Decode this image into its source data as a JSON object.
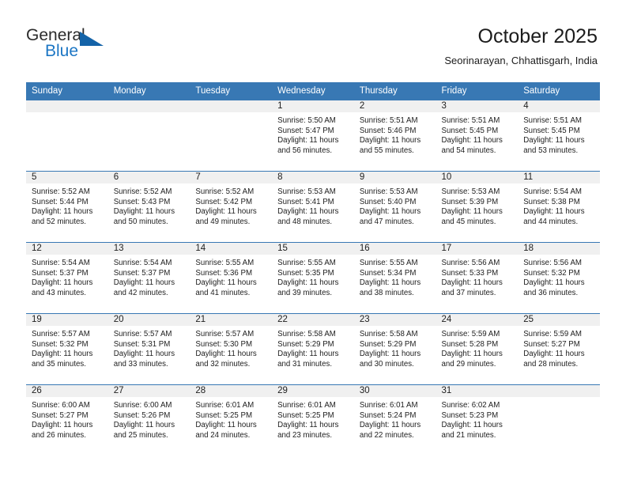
{
  "brand": {
    "name_part1": "General",
    "name_part2": "Blue",
    "triangle_icon": "triangle-icon",
    "accent_color": "#1463a8",
    "text_color": "#2b2b2b"
  },
  "header": {
    "title": "October 2025",
    "subtitle": "Seorinarayan, Chhattisgarh, India"
  },
  "theme": {
    "header_blue": "#3878b4",
    "daynum_band": "#f0f0f0",
    "text": "#1e1e1e"
  },
  "calendar": {
    "weekday_headers": [
      "Sunday",
      "Monday",
      "Tuesday",
      "Wednesday",
      "Thursday",
      "Friday",
      "Saturday"
    ],
    "weeks": [
      [
        {
          "day": "",
          "sunrise": "",
          "sunset": "",
          "daylight_line1": "",
          "daylight_line2": ""
        },
        {
          "day": "",
          "sunrise": "",
          "sunset": "",
          "daylight_line1": "",
          "daylight_line2": ""
        },
        {
          "day": "",
          "sunrise": "",
          "sunset": "",
          "daylight_line1": "",
          "daylight_line2": ""
        },
        {
          "day": "1",
          "sunrise": "Sunrise: 5:50 AM",
          "sunset": "Sunset: 5:47 PM",
          "daylight_line1": "Daylight: 11 hours",
          "daylight_line2": "and 56 minutes."
        },
        {
          "day": "2",
          "sunrise": "Sunrise: 5:51 AM",
          "sunset": "Sunset: 5:46 PM",
          "daylight_line1": "Daylight: 11 hours",
          "daylight_line2": "and 55 minutes."
        },
        {
          "day": "3",
          "sunrise": "Sunrise: 5:51 AM",
          "sunset": "Sunset: 5:45 PM",
          "daylight_line1": "Daylight: 11 hours",
          "daylight_line2": "and 54 minutes."
        },
        {
          "day": "4",
          "sunrise": "Sunrise: 5:51 AM",
          "sunset": "Sunset: 5:45 PM",
          "daylight_line1": "Daylight: 11 hours",
          "daylight_line2": "and 53 minutes."
        }
      ],
      [
        {
          "day": "5",
          "sunrise": "Sunrise: 5:52 AM",
          "sunset": "Sunset: 5:44 PM",
          "daylight_line1": "Daylight: 11 hours",
          "daylight_line2": "and 52 minutes."
        },
        {
          "day": "6",
          "sunrise": "Sunrise: 5:52 AM",
          "sunset": "Sunset: 5:43 PM",
          "daylight_line1": "Daylight: 11 hours",
          "daylight_line2": "and 50 minutes."
        },
        {
          "day": "7",
          "sunrise": "Sunrise: 5:52 AM",
          "sunset": "Sunset: 5:42 PM",
          "daylight_line1": "Daylight: 11 hours",
          "daylight_line2": "and 49 minutes."
        },
        {
          "day": "8",
          "sunrise": "Sunrise: 5:53 AM",
          "sunset": "Sunset: 5:41 PM",
          "daylight_line1": "Daylight: 11 hours",
          "daylight_line2": "and 48 minutes."
        },
        {
          "day": "9",
          "sunrise": "Sunrise: 5:53 AM",
          "sunset": "Sunset: 5:40 PM",
          "daylight_line1": "Daylight: 11 hours",
          "daylight_line2": "and 47 minutes."
        },
        {
          "day": "10",
          "sunrise": "Sunrise: 5:53 AM",
          "sunset": "Sunset: 5:39 PM",
          "daylight_line1": "Daylight: 11 hours",
          "daylight_line2": "and 45 minutes."
        },
        {
          "day": "11",
          "sunrise": "Sunrise: 5:54 AM",
          "sunset": "Sunset: 5:38 PM",
          "daylight_line1": "Daylight: 11 hours",
          "daylight_line2": "and 44 minutes."
        }
      ],
      [
        {
          "day": "12",
          "sunrise": "Sunrise: 5:54 AM",
          "sunset": "Sunset: 5:37 PM",
          "daylight_line1": "Daylight: 11 hours",
          "daylight_line2": "and 43 minutes."
        },
        {
          "day": "13",
          "sunrise": "Sunrise: 5:54 AM",
          "sunset": "Sunset: 5:37 PM",
          "daylight_line1": "Daylight: 11 hours",
          "daylight_line2": "and 42 minutes."
        },
        {
          "day": "14",
          "sunrise": "Sunrise: 5:55 AM",
          "sunset": "Sunset: 5:36 PM",
          "daylight_line1": "Daylight: 11 hours",
          "daylight_line2": "and 41 minutes."
        },
        {
          "day": "15",
          "sunrise": "Sunrise: 5:55 AM",
          "sunset": "Sunset: 5:35 PM",
          "daylight_line1": "Daylight: 11 hours",
          "daylight_line2": "and 39 minutes."
        },
        {
          "day": "16",
          "sunrise": "Sunrise: 5:55 AM",
          "sunset": "Sunset: 5:34 PM",
          "daylight_line1": "Daylight: 11 hours",
          "daylight_line2": "and 38 minutes."
        },
        {
          "day": "17",
          "sunrise": "Sunrise: 5:56 AM",
          "sunset": "Sunset: 5:33 PM",
          "daylight_line1": "Daylight: 11 hours",
          "daylight_line2": "and 37 minutes."
        },
        {
          "day": "18",
          "sunrise": "Sunrise: 5:56 AM",
          "sunset": "Sunset: 5:32 PM",
          "daylight_line1": "Daylight: 11 hours",
          "daylight_line2": "and 36 minutes."
        }
      ],
      [
        {
          "day": "19",
          "sunrise": "Sunrise: 5:57 AM",
          "sunset": "Sunset: 5:32 PM",
          "daylight_line1": "Daylight: 11 hours",
          "daylight_line2": "and 35 minutes."
        },
        {
          "day": "20",
          "sunrise": "Sunrise: 5:57 AM",
          "sunset": "Sunset: 5:31 PM",
          "daylight_line1": "Daylight: 11 hours",
          "daylight_line2": "and 33 minutes."
        },
        {
          "day": "21",
          "sunrise": "Sunrise: 5:57 AM",
          "sunset": "Sunset: 5:30 PM",
          "daylight_line1": "Daylight: 11 hours",
          "daylight_line2": "and 32 minutes."
        },
        {
          "day": "22",
          "sunrise": "Sunrise: 5:58 AM",
          "sunset": "Sunset: 5:29 PM",
          "daylight_line1": "Daylight: 11 hours",
          "daylight_line2": "and 31 minutes."
        },
        {
          "day": "23",
          "sunrise": "Sunrise: 5:58 AM",
          "sunset": "Sunset: 5:29 PM",
          "daylight_line1": "Daylight: 11 hours",
          "daylight_line2": "and 30 minutes."
        },
        {
          "day": "24",
          "sunrise": "Sunrise: 5:59 AM",
          "sunset": "Sunset: 5:28 PM",
          "daylight_line1": "Daylight: 11 hours",
          "daylight_line2": "and 29 minutes."
        },
        {
          "day": "25",
          "sunrise": "Sunrise: 5:59 AM",
          "sunset": "Sunset: 5:27 PM",
          "daylight_line1": "Daylight: 11 hours",
          "daylight_line2": "and 28 minutes."
        }
      ],
      [
        {
          "day": "26",
          "sunrise": "Sunrise: 6:00 AM",
          "sunset": "Sunset: 5:27 PM",
          "daylight_line1": "Daylight: 11 hours",
          "daylight_line2": "and 26 minutes."
        },
        {
          "day": "27",
          "sunrise": "Sunrise: 6:00 AM",
          "sunset": "Sunset: 5:26 PM",
          "daylight_line1": "Daylight: 11 hours",
          "daylight_line2": "and 25 minutes."
        },
        {
          "day": "28",
          "sunrise": "Sunrise: 6:01 AM",
          "sunset": "Sunset: 5:25 PM",
          "daylight_line1": "Daylight: 11 hours",
          "daylight_line2": "and 24 minutes."
        },
        {
          "day": "29",
          "sunrise": "Sunrise: 6:01 AM",
          "sunset": "Sunset: 5:25 PM",
          "daylight_line1": "Daylight: 11 hours",
          "daylight_line2": "and 23 minutes."
        },
        {
          "day": "30",
          "sunrise": "Sunrise: 6:01 AM",
          "sunset": "Sunset: 5:24 PM",
          "daylight_line1": "Daylight: 11 hours",
          "daylight_line2": "and 22 minutes."
        },
        {
          "day": "31",
          "sunrise": "Sunrise: 6:02 AM",
          "sunset": "Sunset: 5:23 PM",
          "daylight_line1": "Daylight: 11 hours",
          "daylight_line2": "and 21 minutes."
        },
        {
          "day": "",
          "sunrise": "",
          "sunset": "",
          "daylight_line1": "",
          "daylight_line2": ""
        }
      ]
    ]
  }
}
